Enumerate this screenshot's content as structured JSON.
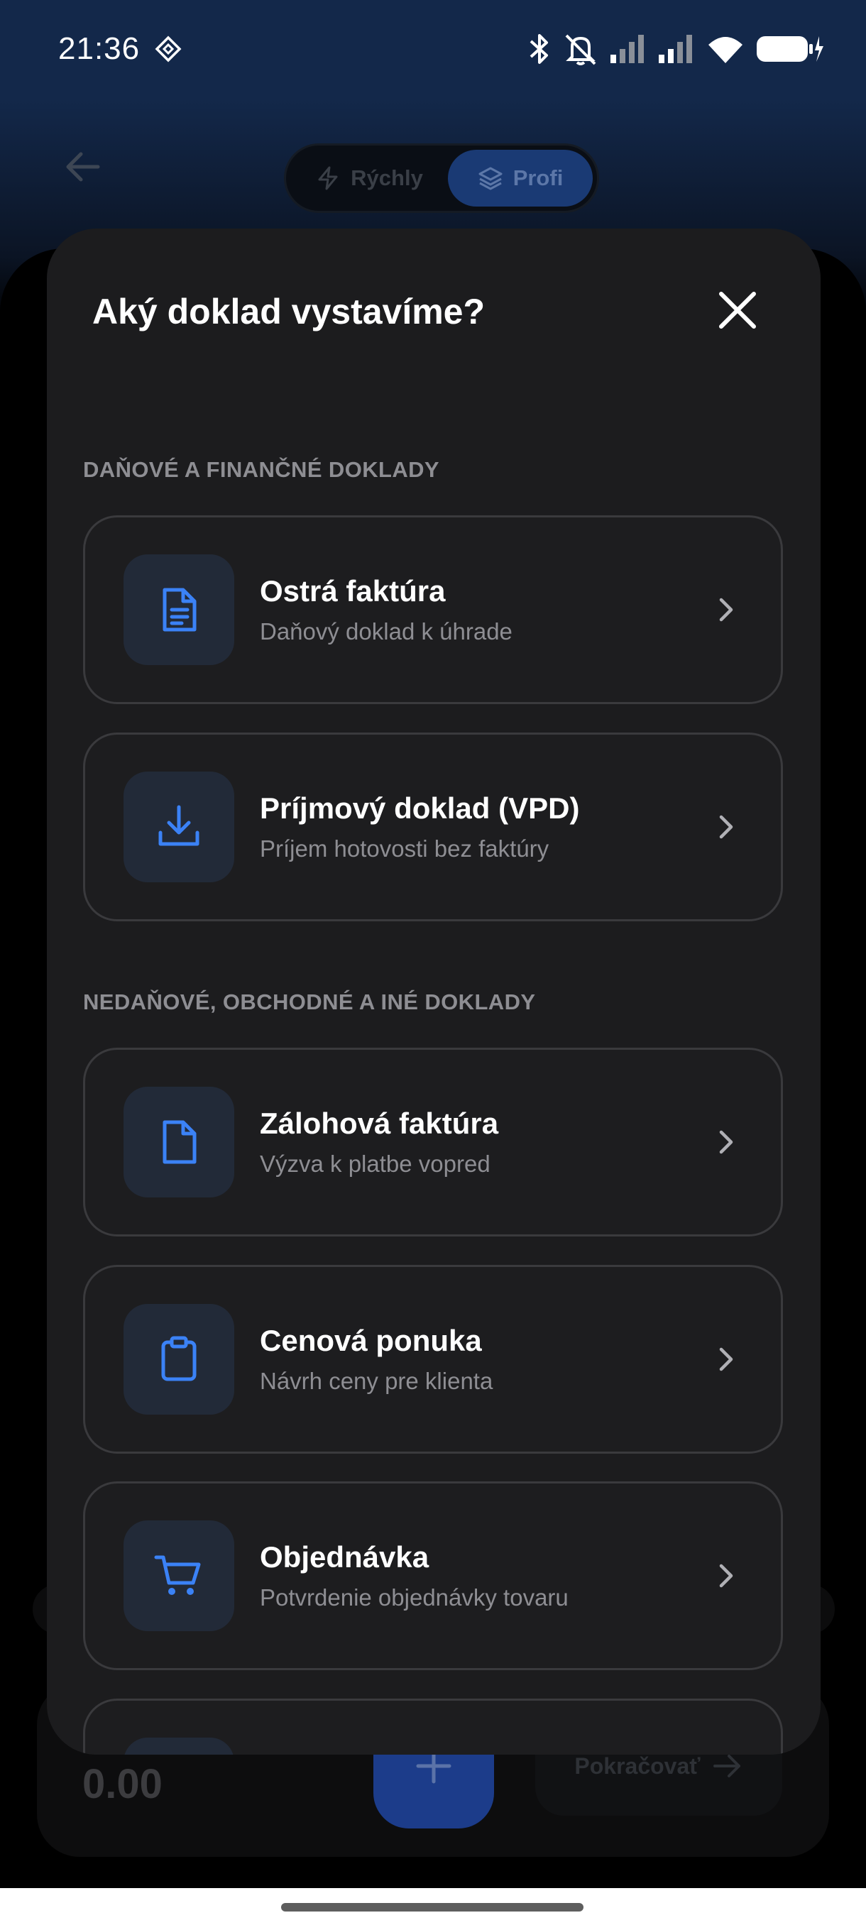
{
  "status_bar": {
    "time": "21:36"
  },
  "header": {
    "mode_quick": "Rýchly",
    "mode_profi": "Profi"
  },
  "modal": {
    "title": "Aký doklad vystavíme?",
    "sections": [
      {
        "label": "DAŇOVÉ A FINANČNÉ DOKLADY",
        "items": [
          {
            "title": "Ostrá faktúra",
            "subtitle": "Daňový doklad k úhrade",
            "icon": "file-text-icon"
          },
          {
            "title": "Príjmový doklad (VPD)",
            "subtitle": "Príjem hotovosti bez faktúry",
            "icon": "download-icon"
          }
        ]
      },
      {
        "label": "NEDAŇOVÉ, OBCHODNÉ A INÉ DOKLADY",
        "items": [
          {
            "title": "Zálohová faktúra",
            "subtitle": "Výzva k platbe vopred",
            "icon": "file-icon"
          },
          {
            "title": "Cenová ponuka",
            "subtitle": "Návrh ceny pre klienta",
            "icon": "clipboard-icon"
          },
          {
            "title": "Objednávka",
            "subtitle": "Potvrdenie objednávky tovaru",
            "icon": "shopping-cart-icon"
          }
        ]
      }
    ]
  },
  "footer": {
    "total": "0.00",
    "continue_label": "Pokračovať"
  },
  "colors": {
    "accent": "#3b82f6",
    "status_bar_bg": "#13284a",
    "modal_bg": "#1c1c1e",
    "icon_box_bg": "#222a38"
  }
}
